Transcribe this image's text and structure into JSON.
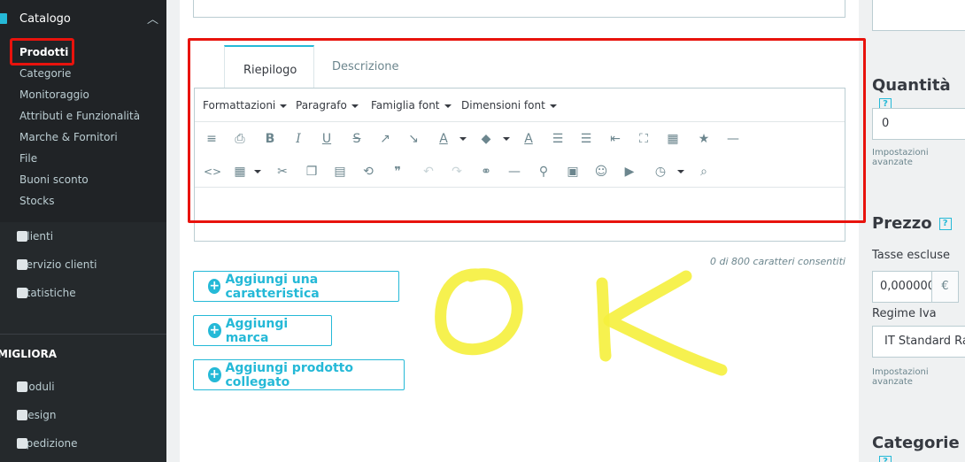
{
  "sidebar": {
    "catalog_label": "Catalogo",
    "catalog_items": [
      "Prodotti",
      "Categorie",
      "Monitoraggio",
      "Attributi e Funzionalità",
      "Marche & Fornitori",
      "File",
      "Buoni sconto",
      "Stocks"
    ],
    "menu_items": [
      "Clienti",
      "Servizio clienti",
      "Statistiche"
    ],
    "section_title": "MIGLIORA",
    "section_items": [
      "Moduli",
      "Design",
      "Spedizione"
    ]
  },
  "tabs": {
    "summary": "Riepilogo",
    "description": "Descrizione"
  },
  "editor": {
    "menus": [
      "Formattazioni",
      "Paragrafo",
      "Famiglia font",
      "Dimensioni font"
    ],
    "counter": "0 di 800 caratteri consentiti"
  },
  "buttons": {
    "add_feature": "Aggiungi una caratteristica",
    "add_brand": "Aggiungi marca",
    "add_related": "Aggiungi prodotto collegato"
  },
  "annotation": "OK",
  "right": {
    "quantity_title": "Quantità",
    "help_glyph": "?",
    "quantity_value": "0",
    "advanced_settings": "Impostazioni avanzate",
    "price_title": "Prezzo",
    "tax_excluded_label": "Tasse escluse",
    "price_value": "0,000000",
    "currency": "€",
    "vat_label": "Regime Iva",
    "vat_value": "IT Standard Rate",
    "categories_title": "Categorie"
  },
  "colors": {
    "accent": "#25b9d7",
    "highlight": "#e8130d",
    "annotation": "#f5ef3c"
  }
}
